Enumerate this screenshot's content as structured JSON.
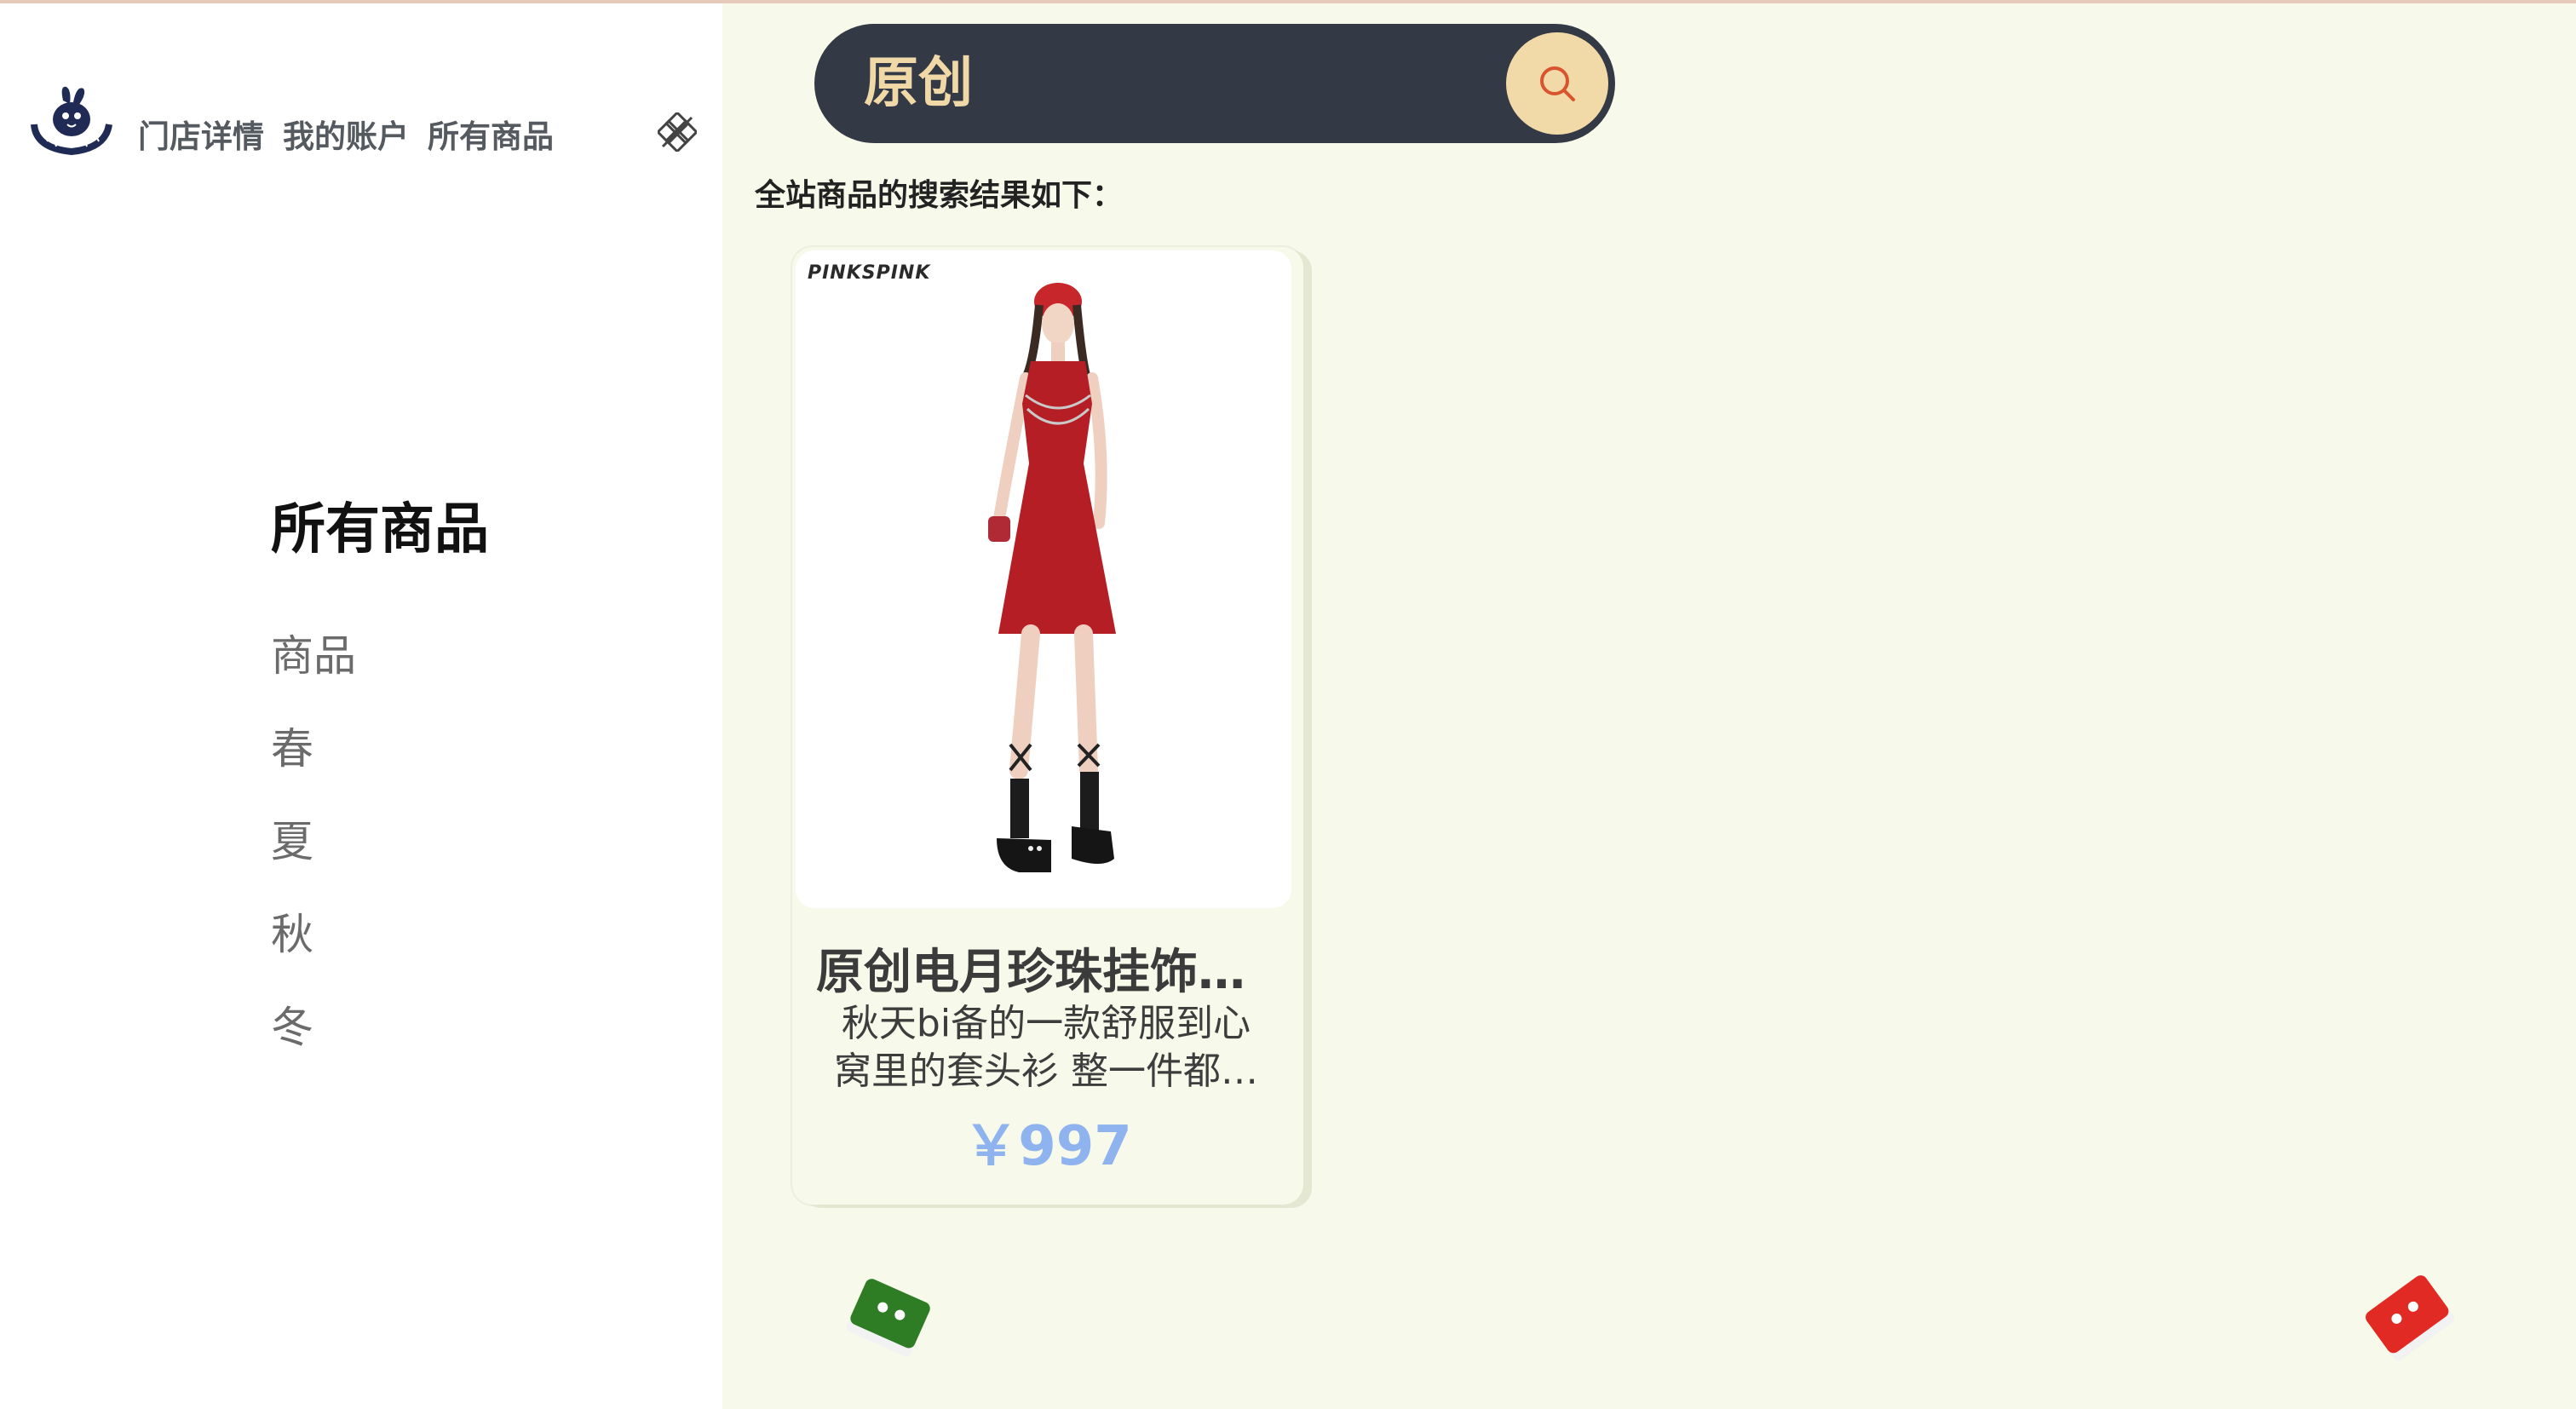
{
  "header": {
    "nav": [
      "门店详情",
      "我的账户",
      "所有商品"
    ]
  },
  "sidebar": {
    "title": "所有商品",
    "categories": [
      "商品",
      "春",
      "夏",
      "秋",
      "冬"
    ]
  },
  "search": {
    "query": "原创"
  },
  "results": {
    "heading": "全站商品的搜索结果如下：",
    "items": [
      {
        "title": "原创电月珍珠挂饰无袖连衣裙",
        "description": "秋天bi备的一款舒服到心窝里的套头衫 整一件都很有设计感",
        "price": "￥997",
        "brand": "PINKSPINK"
      }
    ]
  },
  "colors": {
    "accent": "#f2d9a8",
    "search_bg": "#343a45",
    "price": "#8fb3ee",
    "page_bg": "#f7f9ea"
  },
  "icons": [
    "brand-logo-icon",
    "close-icon",
    "search-icon",
    "green-box-icon",
    "red-box-icon"
  ]
}
